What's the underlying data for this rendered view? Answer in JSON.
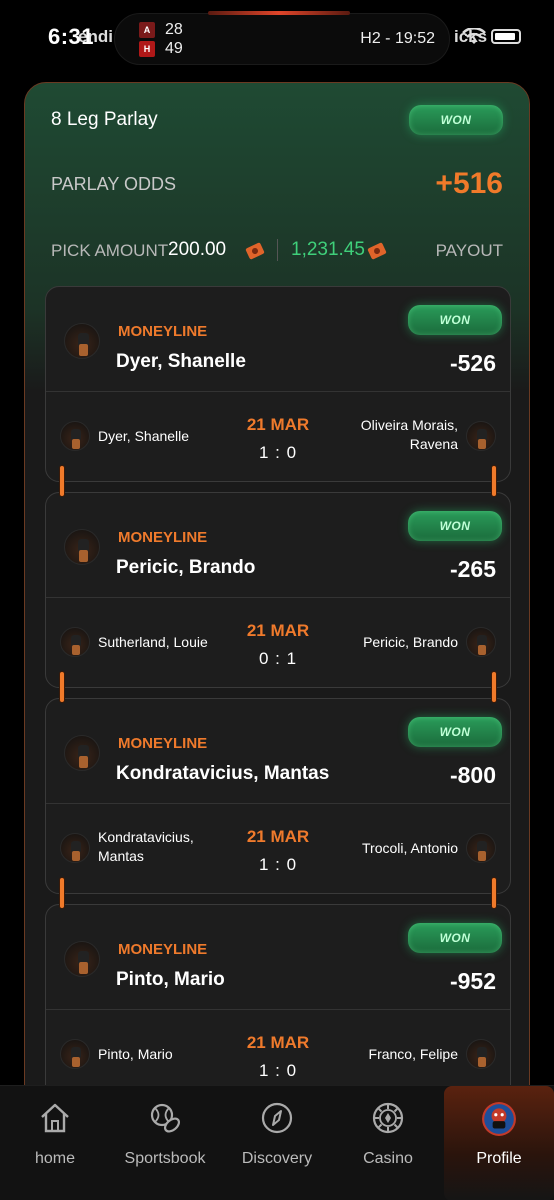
{
  "status_bar": {
    "time": "6:31",
    "left_overflow": "endi",
    "right_overflow": "icks",
    "home_score": "28",
    "away_score": "49",
    "game_clock": "H2 - 19:52"
  },
  "parlay": {
    "title": "8 Leg Parlay",
    "status": "WON",
    "odds_label": "PARLAY ODDS",
    "odds_value": "+516",
    "pick_amount_label": "PICK AMOUNT",
    "pick_amount": "200.00",
    "payout_amount": "1,231.45",
    "payout_label": "PAYOUT"
  },
  "legs": [
    {
      "type": "MONEYLINE",
      "pick": "Dyer, Shanelle",
      "odds": "-526",
      "status": "WON",
      "home": "Dyer, Shanelle",
      "away": "Oliveira Morais, Ravena",
      "date": "21 MAR",
      "score": "1 : 0"
    },
    {
      "type": "MONEYLINE",
      "pick": "Pericic, Brando",
      "odds": "-265",
      "status": "WON",
      "home": "Sutherland, Louie",
      "away": "Pericic, Brando",
      "date": "21 MAR",
      "score": "0 : 1"
    },
    {
      "type": "MONEYLINE",
      "pick": "Kondratavicius, Mantas",
      "odds": "-800",
      "status": "WON",
      "home": "Kondratavicius, Mantas",
      "away": "Trocoli, Antonio",
      "date": "21 MAR",
      "score": "1 : 0"
    },
    {
      "type": "MONEYLINE",
      "pick": "Pinto, Mario",
      "odds": "-952",
      "status": "WON",
      "home": "Pinto, Mario",
      "away": "Franco, Felipe",
      "date": "21 MAR",
      "score": "1 : 0"
    }
  ],
  "nav": [
    {
      "label": "home",
      "icon": "home-icon"
    },
    {
      "label": "Sportsbook",
      "icon": "sportsbook-icon"
    },
    {
      "label": "Discovery",
      "icon": "compass-icon"
    },
    {
      "label": "Casino",
      "icon": "casino-chip-icon"
    },
    {
      "label": "Profile",
      "icon": "avatar-icon",
      "active": true
    }
  ],
  "colors": {
    "accent": "#f07a2a",
    "won_green": "#2a9c5a",
    "payout_green": "#3fcf7a",
    "card": "#1d1d1d"
  }
}
